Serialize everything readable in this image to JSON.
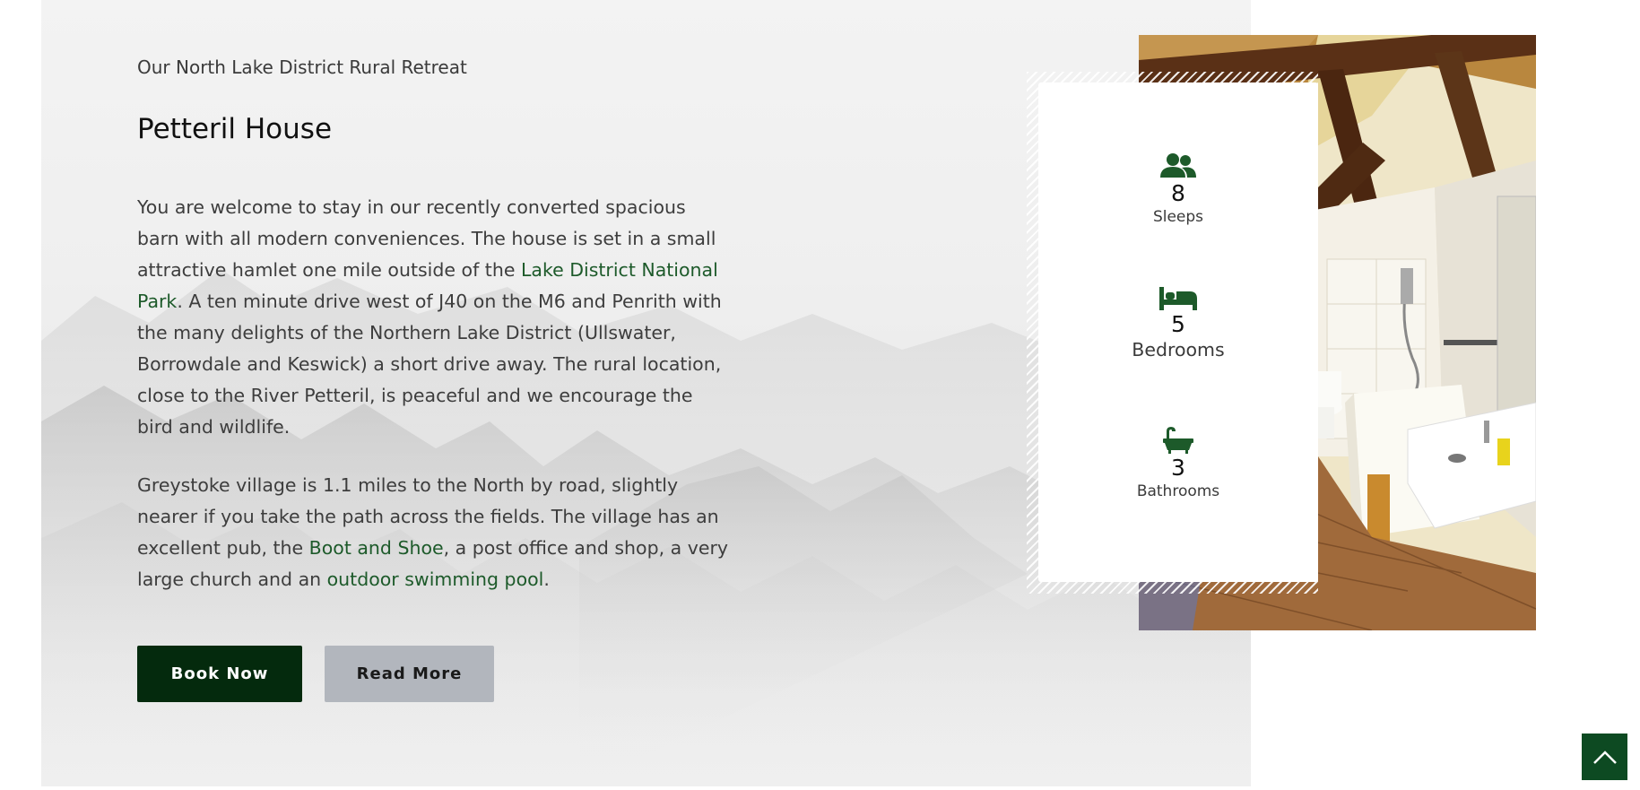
{
  "section": {
    "subtitle": "Our North Lake District Rural Retreat",
    "title": "Petteril House"
  },
  "paragraph1": {
    "text_a": "You are welcome to stay in our recently converted spacious barn with all modern conveniences. The house is set in a small attractive hamlet one mile outside of the ",
    "link_national_park": "Lake District National Park",
    "text_b": ". A ten minute drive west of J40 on the M6 and Penrith with the many delights of the Northern Lake District (Ullswater, Borrowdale and Keswick) a short drive away. The rural location, close to the River Petteril, is peaceful and we encourage the bird and wildlife."
  },
  "paragraph2": {
    "text_a": "Greystoke village is 1.1 miles to the North by road, slightly nearer if you take the path across the fields. The village has an excellent pub, the ",
    "link_pub": "Boot and Shoe",
    "text_b": ", a post office and shop, a very large church and an ",
    "link_pool": "outdoor swimming pool",
    "text_c": "."
  },
  "buttons": {
    "book": "Book Now",
    "read_more": "Read More"
  },
  "stats": [
    {
      "value": "8",
      "label": "Sleeps",
      "icon": "users-icon"
    },
    {
      "value": "5",
      "label": "Bedrooms",
      "icon": "bed-icon"
    },
    {
      "value": "3",
      "label": "Bathrooms",
      "icon": "bath-icon"
    }
  ],
  "colors": {
    "accent_green": "#1d5a2a",
    "book_button": "#042a0d",
    "read_button": "#b2b6bd",
    "back_to_top": "#0d4a22"
  },
  "back_to_top_icon": "chevron-up-icon"
}
